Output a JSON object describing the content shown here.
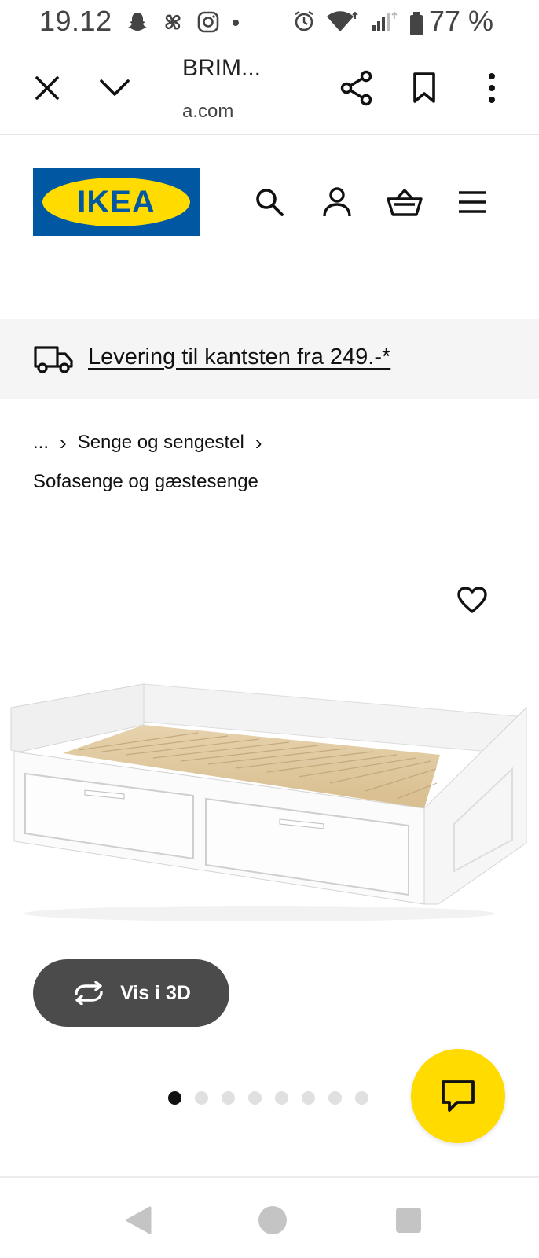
{
  "status_bar": {
    "time": "19.12",
    "battery_text": "77 %",
    "icons_left": [
      "snapchat-icon",
      "pinwheel-icon",
      "instagram-icon",
      "dot-icon"
    ],
    "icons_right": [
      "alarm-icon",
      "wifi-icon",
      "signal-icon",
      "battery-icon"
    ]
  },
  "browser": {
    "title": "BRIM...",
    "url": "a.com",
    "buttons": [
      "close-icon",
      "chevron-down-icon",
      "share-icon",
      "bookmark-icon",
      "more-vertical-icon"
    ]
  },
  "header": {
    "logo_text": "IKEA",
    "icons": [
      "search-icon",
      "user-icon",
      "basket-icon",
      "menu-icon"
    ]
  },
  "delivery": {
    "text": "Levering til kantsten fra 249.-*"
  },
  "breadcrumb": {
    "ellipsis": "...",
    "level1": "Senge og sengestel",
    "level2": "Sofasenge og gæstesenge"
  },
  "product": {
    "view_3d_label": "Vis i 3D",
    "carousel": {
      "total": 8,
      "active_index": 0
    }
  },
  "colors": {
    "ikea_blue": "#0058a3",
    "ikea_yellow": "#ffdb00",
    "button_dark": "#4b4b4b"
  }
}
